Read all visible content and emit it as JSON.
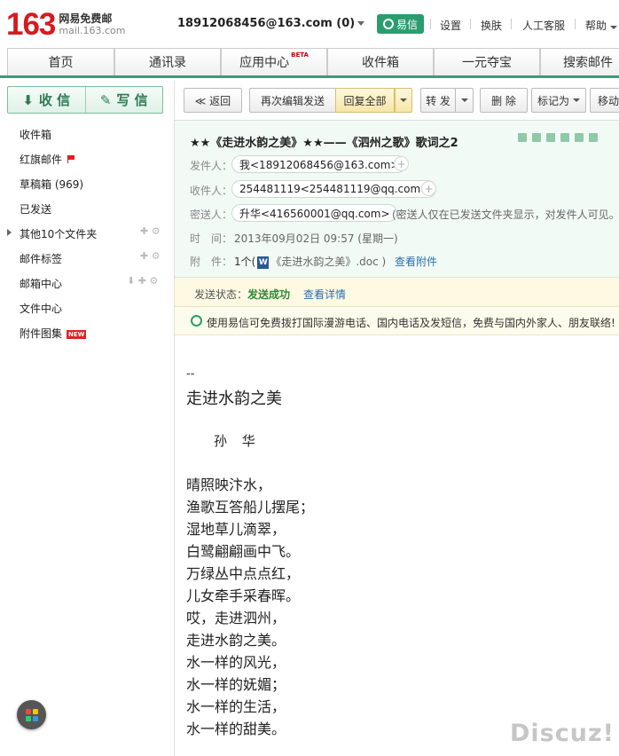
{
  "header": {
    "logo_number": "163",
    "logo_cn": "网易免费邮",
    "logo_domain": "mail.163.com",
    "account": "18912068456@163.com (0)",
    "yixin_label": "易信",
    "links": [
      "设置",
      "换肤",
      "人工客服",
      "帮助"
    ]
  },
  "nav": {
    "tabs": [
      "首页",
      "通讯录",
      "应用中心",
      "收件箱",
      "一元夺宝",
      "搜索邮件"
    ],
    "beta_badge": "BETA",
    "accent_color": "#3d9b76"
  },
  "sidebar": {
    "receive_label": "收 信",
    "compose_label": "写 信",
    "folders": {
      "inbox": "收件箱",
      "flagged": "红旗邮件",
      "drafts": "草稿箱 (969)",
      "sent": "已发送",
      "other": "其他10个文件夹",
      "tags": "邮件标签",
      "mailcenter": "邮箱中心",
      "filecenter": "文件中心",
      "attachments": "附件图集"
    },
    "new_badge": "NEW"
  },
  "toolbar": {
    "back": "≪ 返回",
    "reedit": "再次编辑发送",
    "replyall": "回复全部",
    "forward": "转 发",
    "delete": "删 除",
    "markas": "标记为",
    "move": "移动"
  },
  "mail": {
    "subject": "★★《走进水韵之美》★★——《泗州之歌》歌词之2",
    "from_label": "发件人：",
    "from": "我<18912068456@163.com>",
    "to_label": "收件人：",
    "to": "254481119<254481119@qq.com>",
    "bcc_label": "密送人：",
    "bcc": "升华<416560001@qq.com>",
    "bcc_note": "(密送人仅在已发送文件夹显示，对发件人可见。",
    "time_label": "时　间：",
    "time": "2013年09月02日 09:57 (星期一)",
    "attach_label": "附　件：",
    "attach_count": "1个(",
    "attach_name": "《走进水韵之美》.doc )",
    "attach_view": "查看附件",
    "word_icon_letter": "W"
  },
  "send_status": {
    "label": "发送状态：",
    "value": "发送成功",
    "detail": "查看详情"
  },
  "promo": {
    "text": "使用易信可免费拨打国际漫游电话、国内电话及发短信，免费与国内外家人、朋友联络!"
  },
  "body": {
    "sig": "--",
    "title": "走进水韵之美",
    "author": "孙 华",
    "lines": [
      "晴照映汴水，",
      "渔歌互答船儿摆尾；",
      "湿地草儿滴翠，",
      "白鹭翩翩画中飞。",
      "万绿丛中点点红，",
      "儿女牵手采春晖。",
      "哎，走进泗州，",
      "走进水韵之美。",
      "水一样的风光，",
      "水一样的妩媚；",
      "水一样的生活，",
      "水一样的甜美。"
    ]
  },
  "watermark": "Discuz!"
}
